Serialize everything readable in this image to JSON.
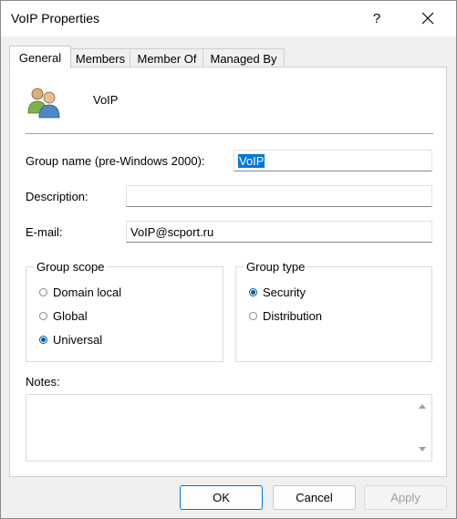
{
  "window": {
    "title": "VoIP Properties",
    "help_label": "?"
  },
  "tabs": [
    {
      "label": "General",
      "active": true
    },
    {
      "label": "Members",
      "active": false
    },
    {
      "label": "Member Of",
      "active": false
    },
    {
      "label": "Managed By",
      "active": false
    }
  ],
  "header": {
    "group_icon": "group-users-icon",
    "name": "VoIP"
  },
  "fields": {
    "group_name_label": "Group name (pre-Windows 2000):",
    "group_name_value": "VoIP",
    "description_label": "Description:",
    "description_value": "",
    "email_label": "E-mail:",
    "email_value": "VoIP@scport.ru"
  },
  "group_scope": {
    "title": "Group scope",
    "options": [
      {
        "label": "Domain local",
        "selected": false
      },
      {
        "label": "Global",
        "selected": false
      },
      {
        "label": "Universal",
        "selected": true
      }
    ]
  },
  "group_type": {
    "title": "Group type",
    "options": [
      {
        "label": "Security",
        "selected": true
      },
      {
        "label": "Distribution",
        "selected": false
      }
    ]
  },
  "notes": {
    "label": "Notes:",
    "value": ""
  },
  "buttons": {
    "ok": "OK",
    "cancel": "Cancel",
    "apply": "Apply"
  },
  "colors": {
    "accent": "#0078d7",
    "radio_selected": "#0058a6"
  }
}
